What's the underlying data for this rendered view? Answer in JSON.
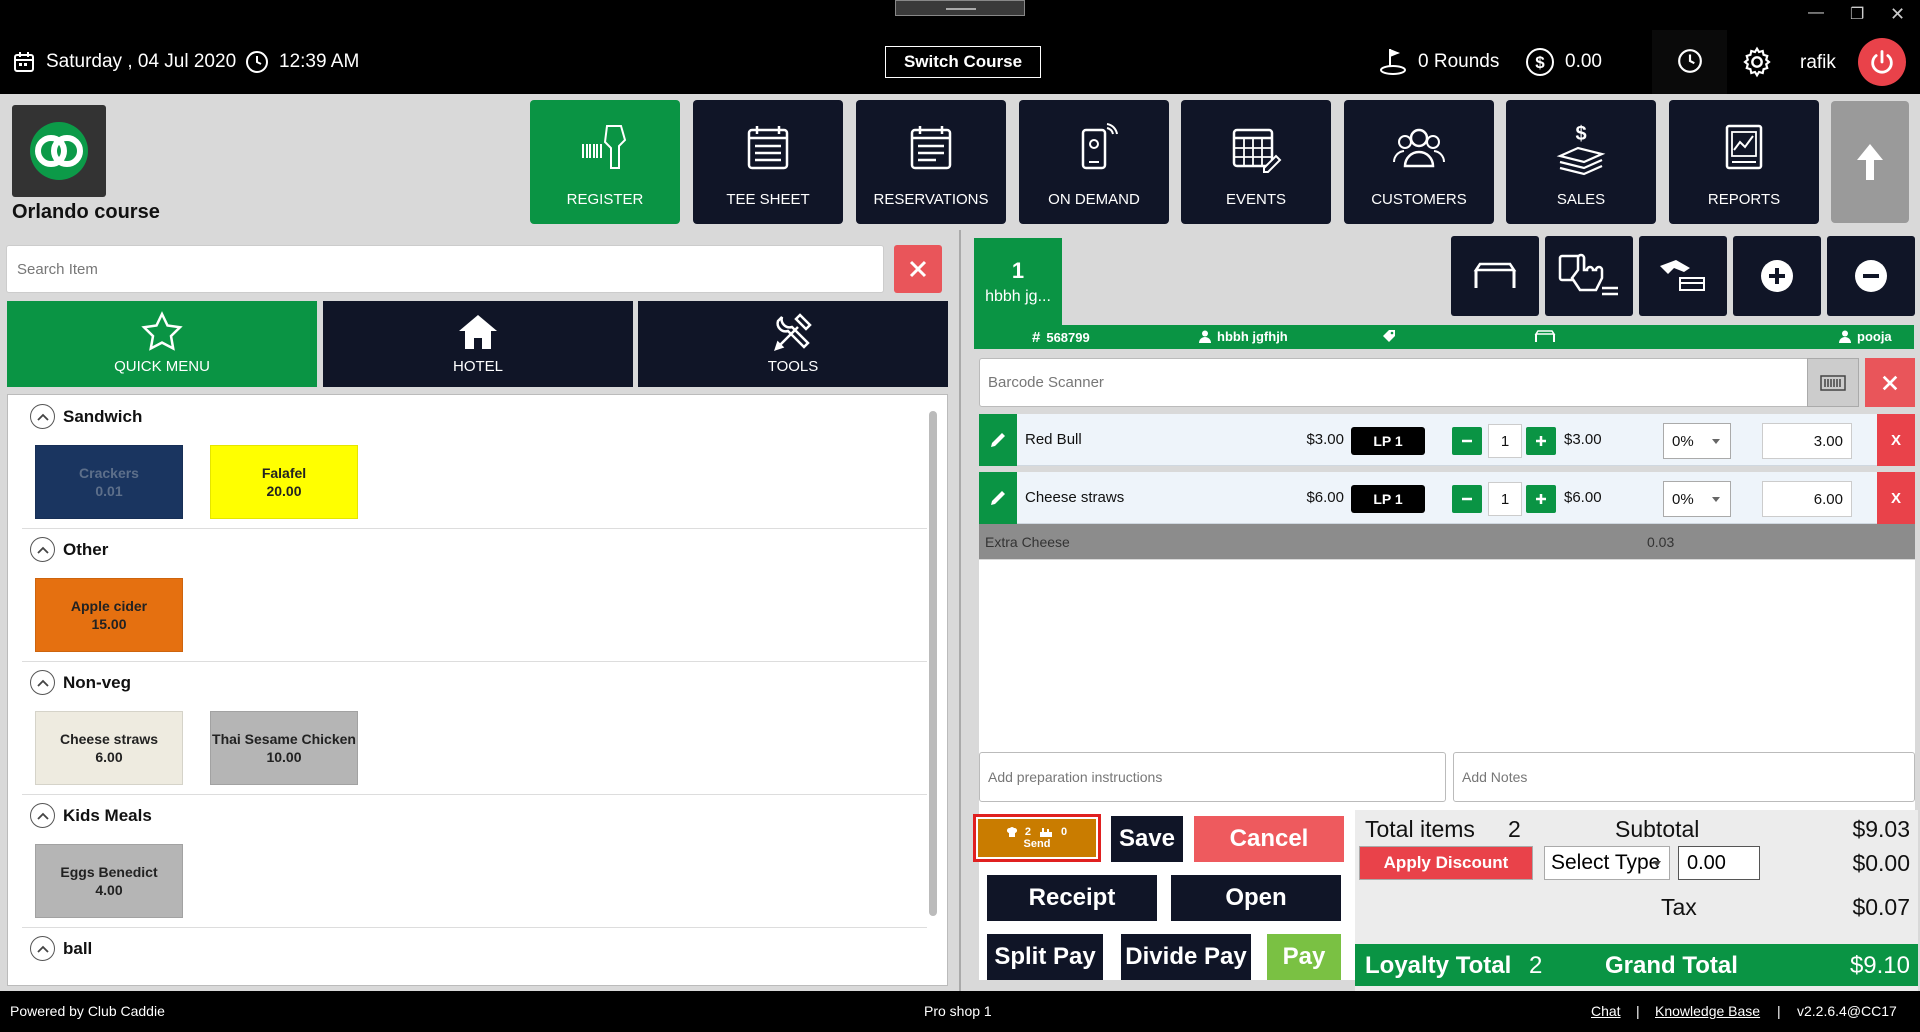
{
  "topbar": {
    "date": "Saturday ,  04 Jul 2020",
    "time": "12:39 AM",
    "switch_course": "Switch Course",
    "rounds": "0 Rounds",
    "balance": "0.00",
    "user": "rafik"
  },
  "header": {
    "course_name": "Orlando course",
    "nav": [
      {
        "label": "REGISTER",
        "icon": "barcode-scanner-icon",
        "active": true
      },
      {
        "label": "TEE SHEET",
        "icon": "list-icon"
      },
      {
        "label": "RESERVATIONS",
        "icon": "calendar-list-icon"
      },
      {
        "label": "ON DEMAND",
        "icon": "mobile-icon"
      },
      {
        "label": "EVENTS",
        "icon": "calendar-edit-icon"
      },
      {
        "label": "CUSTOMERS",
        "icon": "users-icon"
      },
      {
        "label": "SALES",
        "icon": "money-icon"
      },
      {
        "label": "REPORTS",
        "icon": "chart-report-icon"
      }
    ]
  },
  "left": {
    "search_placeholder": "Search Item",
    "categories": [
      "QUICK MENU",
      "HOTEL",
      "TOOLS"
    ],
    "sections": [
      {
        "title": "Sandwich",
        "items": [
          {
            "name": "Crackers",
            "price": "0.01",
            "bg": "#1a3560",
            "fg": "#5d6f8a"
          },
          {
            "name": "Falafel",
            "price": "20.00",
            "bg": "#ffff00",
            "fg": "#222"
          }
        ]
      },
      {
        "title": "Other",
        "items": [
          {
            "name": "Apple cider",
            "price": "15.00",
            "bg": "#e57010",
            "fg": "#222"
          }
        ]
      },
      {
        "title": "Non-veg",
        "items": [
          {
            "name": "Cheese straws",
            "price": "6.00",
            "bg": "#eeebe0",
            "fg": "#222"
          },
          {
            "name": "Thai Sesame Chicken",
            "price": "10.00",
            "bg": "#b5b5b5",
            "fg": "#222"
          }
        ]
      },
      {
        "title": "Kids Meals",
        "items": [
          {
            "name": "Eggs Benedict",
            "price": "4.00",
            "bg": "#b5b5b5",
            "fg": "#222"
          }
        ]
      },
      {
        "title": "ball",
        "items": []
      }
    ]
  },
  "order": {
    "tab_number": "1",
    "tab_name": "hbbh jg...",
    "ticket": "568799",
    "customer": "hbbh jgfhjh",
    "server": "pooja",
    "barcode_placeholder": "Barcode Scanner",
    "lines": [
      {
        "name": "Red Bull",
        "price": "$3.00",
        "lp": "LP  1",
        "qty": "1",
        "total": "$3.00",
        "discount": "0%",
        "amount": "3.00",
        "del": "X"
      },
      {
        "name": "Cheese straws",
        "price": "$6.00",
        "lp": "LP  1",
        "qty": "1",
        "total": "$6.00",
        "discount": "0%",
        "amount": "6.00",
        "del": "X"
      }
    ],
    "modifier": {
      "name": "Extra Cheese",
      "price": "0.03"
    },
    "prep_placeholder": "Add preparation instructions",
    "notes_placeholder": "Add Notes",
    "send": {
      "count1": "2",
      "count2": "0",
      "label": "Send"
    },
    "buttons": {
      "save": "Save",
      "cancel": "Cancel",
      "receipt": "Receipt",
      "open": "Open",
      "split_pay": "Split Pay",
      "divide_pay": "Divide Pay",
      "pay": "Pay"
    },
    "totals": {
      "total_items_label": "Total items",
      "total_items": "2",
      "subtotal_label": "Subtotal",
      "subtotal": "$9.03",
      "apply_discount": "Apply Discount",
      "select_type": "Select Type",
      "discount_value": "0.00",
      "discount_amount": "$0.00",
      "tax_label": "Tax",
      "tax": "$0.07",
      "loyalty_label": "Loyalty Total",
      "loyalty": "2",
      "grand_label": "Grand Total",
      "grand": "$9.10"
    }
  },
  "footer": {
    "powered": "Powered by Club Caddie",
    "location": "Pro shop 1",
    "chat": "Chat",
    "kb": "Knowledge Base",
    "version": "v2.2.6.4@CC17"
  },
  "colors": {
    "green": "#0a9444",
    "navy": "#101527",
    "red": "#e9424a"
  }
}
